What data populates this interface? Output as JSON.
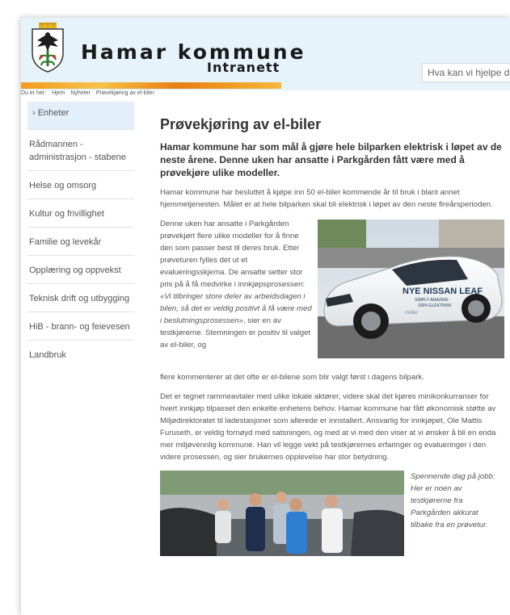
{
  "header": {
    "brand_title": "Hamar kommune",
    "brand_subtitle": "Intranett",
    "search_placeholder": "Hva kan vi hjelpe deg med?"
  },
  "breadcrumb": {
    "prefix": "Du er her:",
    "items": [
      "Hjem",
      "Nyheter",
      "Prøvekjøring av el-biler"
    ]
  },
  "sidebar": {
    "items": [
      {
        "label": "› Enheter"
      },
      {
        "label": "Rådmannen - administrasjon - stabene"
      },
      {
        "label": "Helse og omsorg"
      },
      {
        "label": "Kultur og frivillighet"
      },
      {
        "label": "Familie og levekår"
      },
      {
        "label": "Opplæring og oppvekst"
      },
      {
        "label": "Teknisk drift og utbygging"
      },
      {
        "label": "HiB - brann- og feievesen"
      },
      {
        "label": "Landbruk"
      }
    ]
  },
  "article": {
    "title": "Prøvekjøring av el-biler",
    "lead": "Hamar kommune har som mål å gjøre hele bilparken elektrisk i løpet av de neste årene. Denne uken har ansatte i Parkgården fått være med å prøvekjøre ulike modeller.",
    "p1": "Hamar kommune har besluttet å kjøpe inn 50 el-biler kommende år til bruk i blant annet hjemmetjenesten. Målet er at hele bilparken skal bli elektrisk i løpet av den neste fireårsperioden.",
    "p2_before": "Denne uken har ansatte i Parkgården prøvekjørt flere ulike modeller for å finne den som passer best til deres bruk. Etter prøveturen fylles det ut et evalueringsskjema. De ansatte setter stor pris på å få medvirke i innkjøpsprosessen: ",
    "p2_quote": "«Vi tilbringer store deler av arbeidsdagen i bilen, så det er veldig positivt å få være med i beslutningsprosessen»",
    "p2_after": ", sier en av testkjørerne. Stemningen er positiv til valget av el-biler, og",
    "p2_cont": "flere kommenterer at det ofte er el-bilene som blir valgt først i dagens bilpark.",
    "p3": "Det er tegnet rammeavtaler med ulike lokale aktører, videre skal det kjøres minikonkurranser for hvert innkjøp tilpasset den enkelte enhetens behov. Hamar kommune har fått økonomisk støtte av Miljødirektoratet til ladestasjoner som allerede er innstallert. Ansvarlig for innkjøpet, Ole Mattis Furuseth, er veldig fornøyd med satsningen, og med at vi med den viser at vi ønsker å bli en enda mer miljøvennlig kommune. Han vil legge vekt på testkjørernes erfaringer og evalueringer i den videre prosessen, og sier brukernes opplevelse har stor betydning.",
    "caption": "Spennende dag på jobb: Her er noen av testkjørerne fra Parkgården akkurat tilbake fra en prøvetur.",
    "car_text": {
      "line1": "NYE NISSAN LEAF",
      "line2": "SIMPLY AMAZING",
      "line3": "100% ELEKTRISK",
      "dealer": "möller"
    }
  },
  "colors": {
    "header_bg": "#e7f3fb",
    "sidebar_active_bg": "#e3f0fa",
    "stripe": "#f29b1d"
  }
}
